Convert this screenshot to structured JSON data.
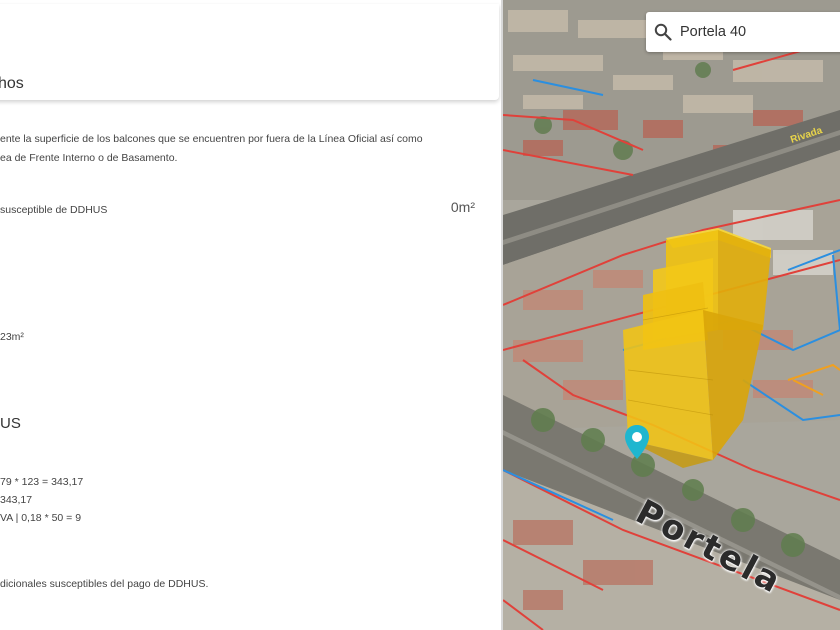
{
  "panel": {
    "title": "chos",
    "desc_line1": "ente la superficie de los balcones que se encuentren por fuera de la Línea Oficial así como",
    "desc_line2": "ea de Frente Interno o de Basamento.",
    "susceptible_label": "susceptible de DDHUS",
    "susceptible_value": "0m²",
    "area_value": "23m²",
    "section_title": "US",
    "calc_line1": "79 * 123 = 343,17",
    "calc_line2": "343,17",
    "calc_line3": "VA | 0,18 * 50 = 9",
    "footer_note": "dicionales susceptibles del pago de DDHUS."
  },
  "map": {
    "search_value": "Portela 40",
    "street_label": "Portela",
    "road_label": "Rivada",
    "building_color": "#f0c20f",
    "marker_color": "#1fb6cf"
  }
}
